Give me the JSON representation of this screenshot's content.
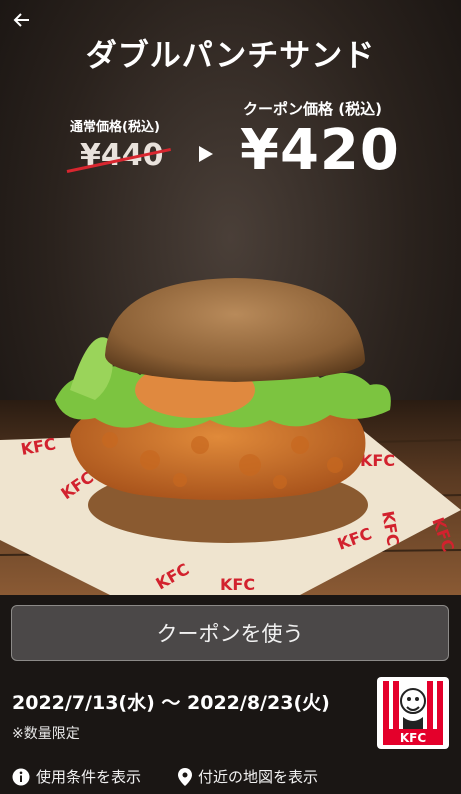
{
  "header": {
    "back_icon": "arrow-left-icon",
    "title": "ダブルパンチサンド"
  },
  "pricing": {
    "regular_label": "通常価格(税込)",
    "regular_price": "¥440",
    "coupon_label": "クーポン価格 (税込)",
    "coupon_price": "¥420"
  },
  "hero": {
    "wrapper_text": [
      "KFC",
      "KFC",
      "KFC",
      "KFC",
      "KFC",
      "KFC",
      "KFC",
      "KFC"
    ]
  },
  "actions": {
    "use_coupon": "クーポンを使う"
  },
  "validity": {
    "period": "2022/7/13(水) 〜 2022/8/23(火)",
    "note": "※数量限定"
  },
  "brand": {
    "logo_text": "KFC",
    "red": "#e4002b"
  },
  "footer": {
    "terms": "使用条件を表示",
    "terms_icon": "info-icon",
    "map": "付近の地図を表示",
    "map_icon": "map-pin-icon"
  }
}
